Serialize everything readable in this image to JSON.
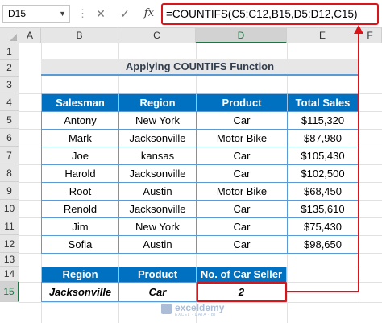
{
  "formula_bar": {
    "name_box": "D15",
    "cancel_icon": "close-icon",
    "enter_icon": "check-icon",
    "fx_label": "fx",
    "formula": "=COUNTIFS(C5:C12,B15,D5:D12,C15)"
  },
  "columns": [
    "A",
    "B",
    "C",
    "D",
    "E",
    "F"
  ],
  "rows": [
    "1",
    "2",
    "3",
    "4",
    "5",
    "6",
    "7",
    "8",
    "9",
    "10",
    "11",
    "12",
    "13",
    "14",
    "15"
  ],
  "selected_cell": {
    "column": "D",
    "row": "15"
  },
  "title": "Applying COUNTIFS Function",
  "main_table": {
    "headers": [
      "Salesman",
      "Region",
      "Product",
      "Total Sales"
    ],
    "rows": [
      [
        "Antony",
        "New York",
        "Car",
        "$115,320"
      ],
      [
        "Mark",
        "Jacksonville",
        "Motor Bike",
        "$87,980"
      ],
      [
        "Joe",
        "kansas",
        "Car",
        "$105,430"
      ],
      [
        "Harold",
        "Jacksonville",
        "Car",
        "$102,500"
      ],
      [
        "Root",
        "Austin",
        "Motor Bike",
        "$68,450"
      ],
      [
        "Renold",
        "Jacksonville",
        "Car",
        "$135,610"
      ],
      [
        "Jim",
        "New York",
        "Car",
        "$75,430"
      ],
      [
        "Sofia",
        "Austin",
        "Car",
        "$98,650"
      ]
    ]
  },
  "criteria_table": {
    "headers": [
      "Region",
      "Product",
      "No. of Car Seller"
    ],
    "values": [
      "Jacksonville",
      "Car",
      "2"
    ]
  },
  "watermark": {
    "name": "exceldemy",
    "tagline": "EXCEL · DATA · BI"
  },
  "colors": {
    "header_blue": "#0070c0",
    "border_blue": "#5b9bd5",
    "highlight_red": "#d9141b",
    "excel_green": "#217346"
  }
}
